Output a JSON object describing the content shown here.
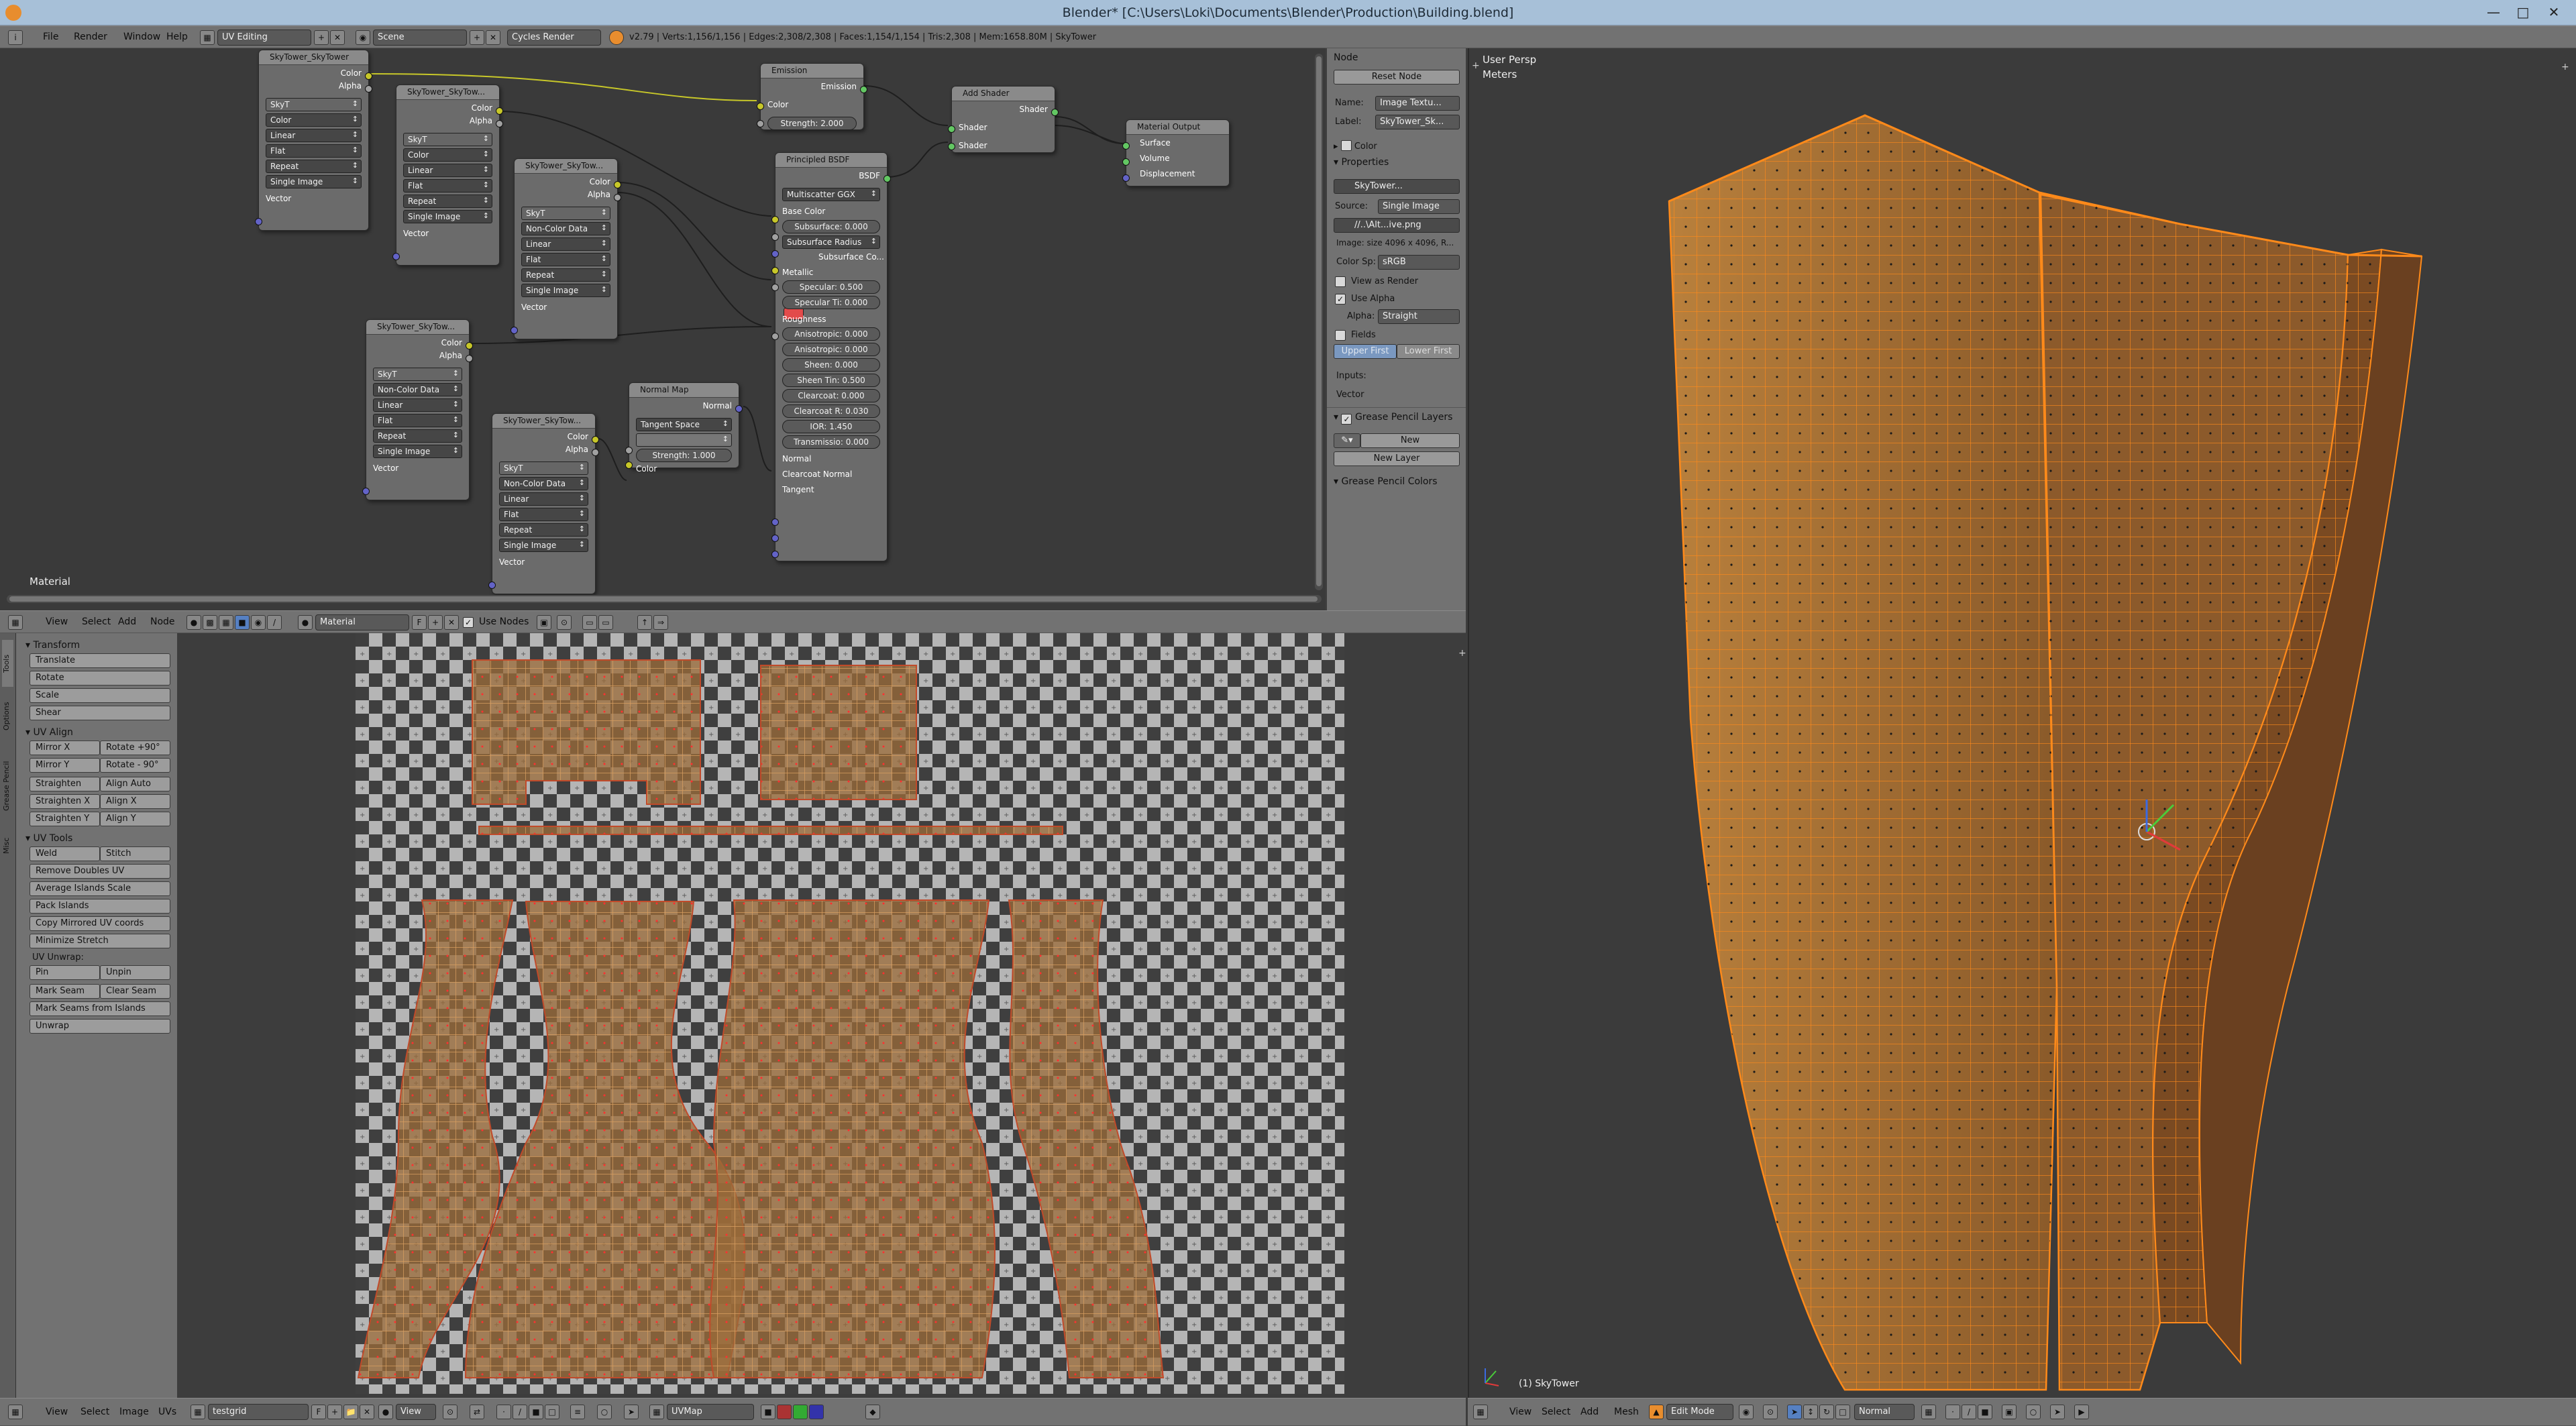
{
  "window": {
    "title": "Blender* [C:\\Users\\Loki\\Documents\\Blender\\Production\\Building.blend]"
  },
  "topbar": {
    "menus": [
      "File",
      "Render",
      "Window",
      "Help"
    ],
    "screen_layout": "UV Editing",
    "scene": "Scene",
    "render_engine": "Cycles Render",
    "stats": "v2.79 | Verts:1,156/1,156 | Edges:2,308/2,308 | Faces:1,154/1,154 | Tris:2,308 | Mem:1658.80M | SkyTower"
  },
  "node_editor": {
    "tree_label": "Material",
    "header": {
      "menus": [
        "View",
        "Select",
        "Add",
        "Node"
      ],
      "material": "Material",
      "use_nodes": "Use Nodes"
    },
    "image_nodes": [
      {
        "title": "SkyTower_SkyTower",
        "outputs": [
          "Color",
          "Alpha"
        ],
        "image": "SkyT",
        "colorspace": "Color",
        "interpolation": "Linear",
        "projection": "Flat",
        "extension": "Repeat",
        "source": "Single Image",
        "input": "Vector"
      },
      {
        "title": "SkyTower_SkyTow...",
        "outputs": [
          "Color",
          "Alpha"
        ],
        "image": "SkyT",
        "colorspace": "Color",
        "interpolation": "Linear",
        "projection": "Flat",
        "extension": "Repeat",
        "source": "Single Image",
        "input": "Vector"
      },
      {
        "title": "SkyTower_SkyTow...",
        "outputs": [
          "Color",
          "Alpha"
        ],
        "image": "SkyT",
        "colorspace": "Non-Color Data",
        "interpolation": "Linear",
        "projection": "Flat",
        "extension": "Repeat",
        "source": "Single Image",
        "input": "Vector"
      },
      {
        "title": "SkyTower_SkyTow...",
        "outputs": [
          "Color",
          "Alpha"
        ],
        "image": "SkyT",
        "colorspace": "Non-Color Data",
        "interpolation": "Linear",
        "projection": "Flat",
        "extension": "Repeat",
        "source": "Single Image",
        "input": "Vector"
      },
      {
        "title": "SkyTower_SkyTow...",
        "outputs": [
          "Color",
          "Alpha"
        ],
        "image": "SkyT",
        "colorspace": "Non-Color Data",
        "interpolation": "Linear",
        "projection": "Flat",
        "extension": "Repeat",
        "source": "Single Image",
        "input": "Vector"
      }
    ],
    "emission": {
      "title": "Emission",
      "output": "Emission",
      "color": "Color",
      "strength": "Strength: 2.000"
    },
    "add_shader": {
      "title": "Add Shader",
      "output": "Shader",
      "in1": "Shader",
      "in2": "Shader"
    },
    "material_output": {
      "title": "Material Output",
      "inputs": [
        "Surface",
        "Volume",
        "Displacement"
      ]
    },
    "normal_map": {
      "title": "Normal Map",
      "output": "Normal",
      "space": "Tangent Space",
      "strength": "Strength: 1.000",
      "color": "Color"
    },
    "principled": {
      "title": "Principled BSDF",
      "output": "BSDF",
      "distribution": "Multiscatter GGX",
      "base_color": "Base Color",
      "subsurface": "Subsurface: 0.000",
      "subsurface_radius": "Subsurface Radius",
      "subsurface_color": "Subsurface Co...",
      "metallic": "Metallic",
      "specular": "Specular: 0.500",
      "specular_tint": "Specular Ti: 0.000",
      "roughness": "Roughness",
      "anisotropic": "Anisotropic: 0.000",
      "anisotropic_rot": "Anisotropic: 0.000",
      "sheen": "Sheen: 0.000",
      "sheen_tint": "Sheen Tin: 0.500",
      "clearcoat": "Clearcoat: 0.000",
      "clearcoat_r": "Clearcoat R: 0.030",
      "ior": "IOR: 1.450",
      "transmission": "Transmissio: 0.000",
      "normal": "Normal",
      "clearcoat_normal": "Clearcoat Normal",
      "tangent": "Tangent"
    }
  },
  "node_props": {
    "node_header": "Node",
    "reset": "Reset Node",
    "name_label": "Name:",
    "name": "Image Textu...",
    "label_label": "Label:",
    "label": "SkyTower_Sk...",
    "color_section": "Color",
    "properties": "Properties",
    "image_name": "SkyTower...",
    "source_label": "Source:",
    "source": "Single Image",
    "filepath": "//..\\Alt...ive.png",
    "image_info": "Image: size 4096 x 4096, R...",
    "colorspace_label": "Color Sp:",
    "colorspace": "sRGB",
    "view_as_render": "View as Render",
    "use_alpha": "Use Alpha",
    "alpha_label": "Alpha:",
    "alpha": "Straight",
    "fields": "Fields",
    "upper_first": "Upper First",
    "lower_first": "Lower First",
    "inputs": "Inputs:",
    "vector": "Vector",
    "gp_layers": "Grease Pencil Layers",
    "gp_new": "New",
    "gp_new_layer": "New Layer",
    "gp_colors": "Grease Pencil Colors"
  },
  "uv_tools": {
    "tabs": [
      "Tools",
      "Options",
      "Grease Pencil",
      "Misc"
    ],
    "transform": "Transform",
    "transform_buttons": [
      "Translate",
      "Rotate",
      "Scale",
      "Shear"
    ],
    "uv_align": "UV Align",
    "align_pairs": [
      [
        "Mirror X",
        "Rotate +90°"
      ],
      [
        "Mirror Y",
        "Rotate - 90°"
      ],
      [
        "Straighten",
        "Align Auto"
      ],
      [
        "Straighten X",
        "Align X"
      ],
      [
        "Straighten Y",
        "Align Y"
      ]
    ],
    "uv_tools_label": "UV Tools",
    "weld": "Weld",
    "stitch": "Stitch",
    "tools_buttons": [
      "Remove Doubles UV",
      "Average Islands Scale",
      "Pack Islands",
      "Copy Mirrored UV coords",
      "Minimize Stretch"
    ],
    "unwrap_label": "UV Unwrap:",
    "pin": "Pin",
    "unpin": "Unpin",
    "mark_seam": "Mark Seam",
    "clear_seam": "Clear Seam",
    "seams_from_islands": "Mark Seams from Islands",
    "unwrap": "Unwrap"
  },
  "uv_footer": {
    "menus": [
      "View",
      "Select",
      "Image",
      "UVs"
    ],
    "image": "testgrid",
    "view": "View",
    "uvmap": "UVMap"
  },
  "viewport": {
    "view_name": "User Persp",
    "units": "Meters",
    "object": "(1) SkyTower",
    "menus": [
      "View",
      "Select",
      "Add",
      "Mesh"
    ],
    "mode": "Edit Mode",
    "pivot": "Normal"
  },
  "colors": {
    "mesh_wire": "#ff8a1a",
    "mesh_face": "#a06a34",
    "node_body": "#6b6b6b",
    "checker_dark": "#3e3e3e",
    "checker_light": "#b7b7b7",
    "subsurface_color": "#e24b4b"
  }
}
